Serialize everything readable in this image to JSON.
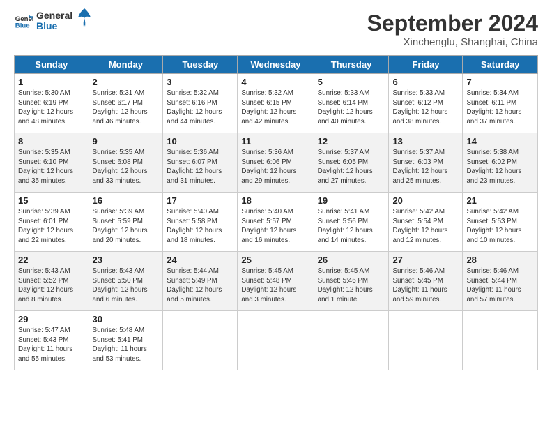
{
  "header": {
    "logo_general": "General",
    "logo_blue": "Blue",
    "month_title": "September 2024",
    "subtitle": "Xinchenglu, Shanghai, China"
  },
  "weekdays": [
    "Sunday",
    "Monday",
    "Tuesday",
    "Wednesday",
    "Thursday",
    "Friday",
    "Saturday"
  ],
  "weeks": [
    [
      {
        "day": "1",
        "info": "Sunrise: 5:30 AM\nSunset: 6:19 PM\nDaylight: 12 hours\nand 48 minutes."
      },
      {
        "day": "2",
        "info": "Sunrise: 5:31 AM\nSunset: 6:17 PM\nDaylight: 12 hours\nand 46 minutes."
      },
      {
        "day": "3",
        "info": "Sunrise: 5:32 AM\nSunset: 6:16 PM\nDaylight: 12 hours\nand 44 minutes."
      },
      {
        "day": "4",
        "info": "Sunrise: 5:32 AM\nSunset: 6:15 PM\nDaylight: 12 hours\nand 42 minutes."
      },
      {
        "day": "5",
        "info": "Sunrise: 5:33 AM\nSunset: 6:14 PM\nDaylight: 12 hours\nand 40 minutes."
      },
      {
        "day": "6",
        "info": "Sunrise: 5:33 AM\nSunset: 6:12 PM\nDaylight: 12 hours\nand 38 minutes."
      },
      {
        "day": "7",
        "info": "Sunrise: 5:34 AM\nSunset: 6:11 PM\nDaylight: 12 hours\nand 37 minutes."
      }
    ],
    [
      {
        "day": "8",
        "info": "Sunrise: 5:35 AM\nSunset: 6:10 PM\nDaylight: 12 hours\nand 35 minutes."
      },
      {
        "day": "9",
        "info": "Sunrise: 5:35 AM\nSunset: 6:08 PM\nDaylight: 12 hours\nand 33 minutes."
      },
      {
        "day": "10",
        "info": "Sunrise: 5:36 AM\nSunset: 6:07 PM\nDaylight: 12 hours\nand 31 minutes."
      },
      {
        "day": "11",
        "info": "Sunrise: 5:36 AM\nSunset: 6:06 PM\nDaylight: 12 hours\nand 29 minutes."
      },
      {
        "day": "12",
        "info": "Sunrise: 5:37 AM\nSunset: 6:05 PM\nDaylight: 12 hours\nand 27 minutes."
      },
      {
        "day": "13",
        "info": "Sunrise: 5:37 AM\nSunset: 6:03 PM\nDaylight: 12 hours\nand 25 minutes."
      },
      {
        "day": "14",
        "info": "Sunrise: 5:38 AM\nSunset: 6:02 PM\nDaylight: 12 hours\nand 23 minutes."
      }
    ],
    [
      {
        "day": "15",
        "info": "Sunrise: 5:39 AM\nSunset: 6:01 PM\nDaylight: 12 hours\nand 22 minutes."
      },
      {
        "day": "16",
        "info": "Sunrise: 5:39 AM\nSunset: 5:59 PM\nDaylight: 12 hours\nand 20 minutes."
      },
      {
        "day": "17",
        "info": "Sunrise: 5:40 AM\nSunset: 5:58 PM\nDaylight: 12 hours\nand 18 minutes."
      },
      {
        "day": "18",
        "info": "Sunrise: 5:40 AM\nSunset: 5:57 PM\nDaylight: 12 hours\nand 16 minutes."
      },
      {
        "day": "19",
        "info": "Sunrise: 5:41 AM\nSunset: 5:56 PM\nDaylight: 12 hours\nand 14 minutes."
      },
      {
        "day": "20",
        "info": "Sunrise: 5:42 AM\nSunset: 5:54 PM\nDaylight: 12 hours\nand 12 minutes."
      },
      {
        "day": "21",
        "info": "Sunrise: 5:42 AM\nSunset: 5:53 PM\nDaylight: 12 hours\nand 10 minutes."
      }
    ],
    [
      {
        "day": "22",
        "info": "Sunrise: 5:43 AM\nSunset: 5:52 PM\nDaylight: 12 hours\nand 8 minutes."
      },
      {
        "day": "23",
        "info": "Sunrise: 5:43 AM\nSunset: 5:50 PM\nDaylight: 12 hours\nand 6 minutes."
      },
      {
        "day": "24",
        "info": "Sunrise: 5:44 AM\nSunset: 5:49 PM\nDaylight: 12 hours\nand 5 minutes."
      },
      {
        "day": "25",
        "info": "Sunrise: 5:45 AM\nSunset: 5:48 PM\nDaylight: 12 hours\nand 3 minutes."
      },
      {
        "day": "26",
        "info": "Sunrise: 5:45 AM\nSunset: 5:46 PM\nDaylight: 12 hours\nand 1 minute."
      },
      {
        "day": "27",
        "info": "Sunrise: 5:46 AM\nSunset: 5:45 PM\nDaylight: 11 hours\nand 59 minutes."
      },
      {
        "day": "28",
        "info": "Sunrise: 5:46 AM\nSunset: 5:44 PM\nDaylight: 11 hours\nand 57 minutes."
      }
    ],
    [
      {
        "day": "29",
        "info": "Sunrise: 5:47 AM\nSunset: 5:43 PM\nDaylight: 11 hours\nand 55 minutes."
      },
      {
        "day": "30",
        "info": "Sunrise: 5:48 AM\nSunset: 5:41 PM\nDaylight: 11 hours\nand 53 minutes."
      },
      {
        "day": "",
        "info": ""
      },
      {
        "day": "",
        "info": ""
      },
      {
        "day": "",
        "info": ""
      },
      {
        "day": "",
        "info": ""
      },
      {
        "day": "",
        "info": ""
      }
    ]
  ]
}
